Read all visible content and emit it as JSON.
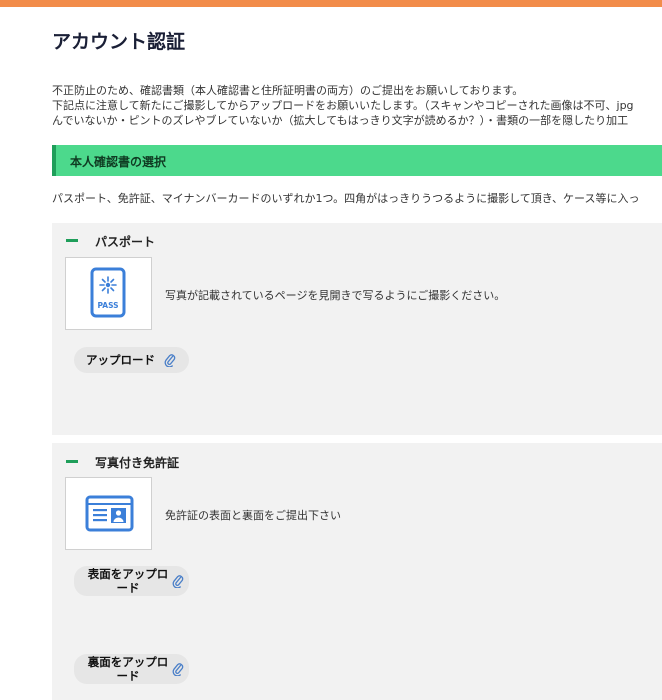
{
  "page": {
    "title": "アカウント認証",
    "intro_lines": [
      "不正防止のため、確認書類（本人確認書と住所証明書の両方）のご提出をお願いしております。",
      "下記点に注意して新たにご撮影してからアップロードをお願いいたします。（スキャンやコピーされた画像は不可、jpg",
      "んでいないか・ピントのズレやブレていないか（拡大してもはっきり文字が読めるか？）・書類の一部を隠したり加工"
    ]
  },
  "section": {
    "heading": "本人確認書の選択",
    "description": "パスポート、免許証、マイナンバーカードのいずれか1つ。四角がはっきりうつるように撮影して頂き、ケース等に入っ"
  },
  "documents": [
    {
      "label": "パスポート",
      "icon": "passport-icon",
      "icon_text": "PASS",
      "description": "写真が記載されているページを見開きで写るようにご撮影ください。",
      "buttons": [
        {
          "label": "アップロード",
          "icon": "paperclip-icon"
        }
      ]
    },
    {
      "label": "写真付き免許証",
      "icon": "id-card-icon",
      "description": "免許証の表面と裏面をご提出下さい",
      "buttons": [
        {
          "label": "表面をアップロード",
          "icon": "paperclip-icon"
        },
        {
          "label": "裏面をアップロード",
          "icon": "paperclip-icon"
        }
      ]
    }
  ],
  "colors": {
    "top_bar": "#f28c4a",
    "section_bar": "#4cd98c",
    "section_accent": "#1f9e5a",
    "icon_blue": "#3b7fd9",
    "card_bg": "#f2f2f2"
  }
}
